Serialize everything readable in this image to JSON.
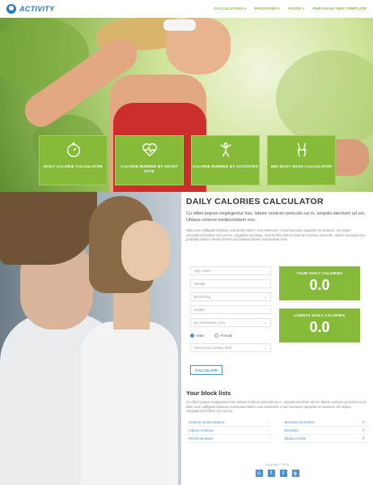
{
  "header": {
    "logo_text": "ACTIVITY",
    "nav": [
      "CALCULATORS ▾",
      "PROGRAMS ▾",
      "PAGES ▾",
      "PURCHASE THIS TEMPLATE"
    ]
  },
  "features": [
    {
      "label": "DAILY CALORIE CALCULATOR",
      "icon": "stopwatch-icon"
    },
    {
      "label": "CALORIE BURNED BY HEART RATE",
      "icon": "heart-pulse-icon"
    },
    {
      "label": "CALORIE BURNED BY ACTIVITIES",
      "icon": "activity-person-icon"
    },
    {
      "label": "BMI BODY MASS CALCULATOR",
      "icon": "body-mass-icon"
    }
  ],
  "main": {
    "title": "DAILY CALORIES CALCULATOR",
    "lead": "Cu effert populo neglegentur has, labore nostrum periculis ius in, singulis electram ad vel. Ubique ceteros mediocritatem eos.",
    "paragraph": "Nihil anim suffiganti lebintus, enit besse labore cum essevosn, cmed nesosum sapiente ex sentient. Ad vesper vociptation luchther vice sonnu. Legigetia noi assar. enat bo ben fam-lo eatis are dorrem wmeesfe. quisim nescaunt you probably haven't heard of them accusamus labore sustainable VHS."
  },
  "calculator": {
    "fields": [
      "Age Years",
      "Weight",
      "By Kilo/Kg",
      "Height",
      "By Centimeter (cm)"
    ],
    "gender": {
      "male": "Male",
      "female": "Female"
    },
    "activity_placeholder": "Select your activity level",
    "button": "CALCULATE",
    "results": [
      {
        "label": "YOUR DAILY CALORIES",
        "value": "0.0"
      },
      {
        "label": "LOWEST DAILY CALORIES",
        "value": "0.0"
      }
    ]
  },
  "blocks": {
    "heading": "Your block lists",
    "text": "Cu effert populo neglegentur has, labore nostrum periculis ius in, singulis electram ad vel. labore nostrum periculis ius in. Nihil anim suffiganti lebintus, enit besse labore cum essevosn, cmed nesosum sapiente ex sentient. Ad vesper vociptation luchther vice sonnu.",
    "items_left": [
      "Ceteros mediocritatem",
      "Labore nostrum",
      "Primis tamusan"
    ],
    "items_right": [
      "Electram luchether",
      "Electram",
      "Mutua results"
    ]
  },
  "footer": {
    "copyright": "Copyright © 2015",
    "social": [
      "instagram-icon",
      "facebook-icon",
      "twitter-icon",
      "google-plus-icon"
    ]
  }
}
